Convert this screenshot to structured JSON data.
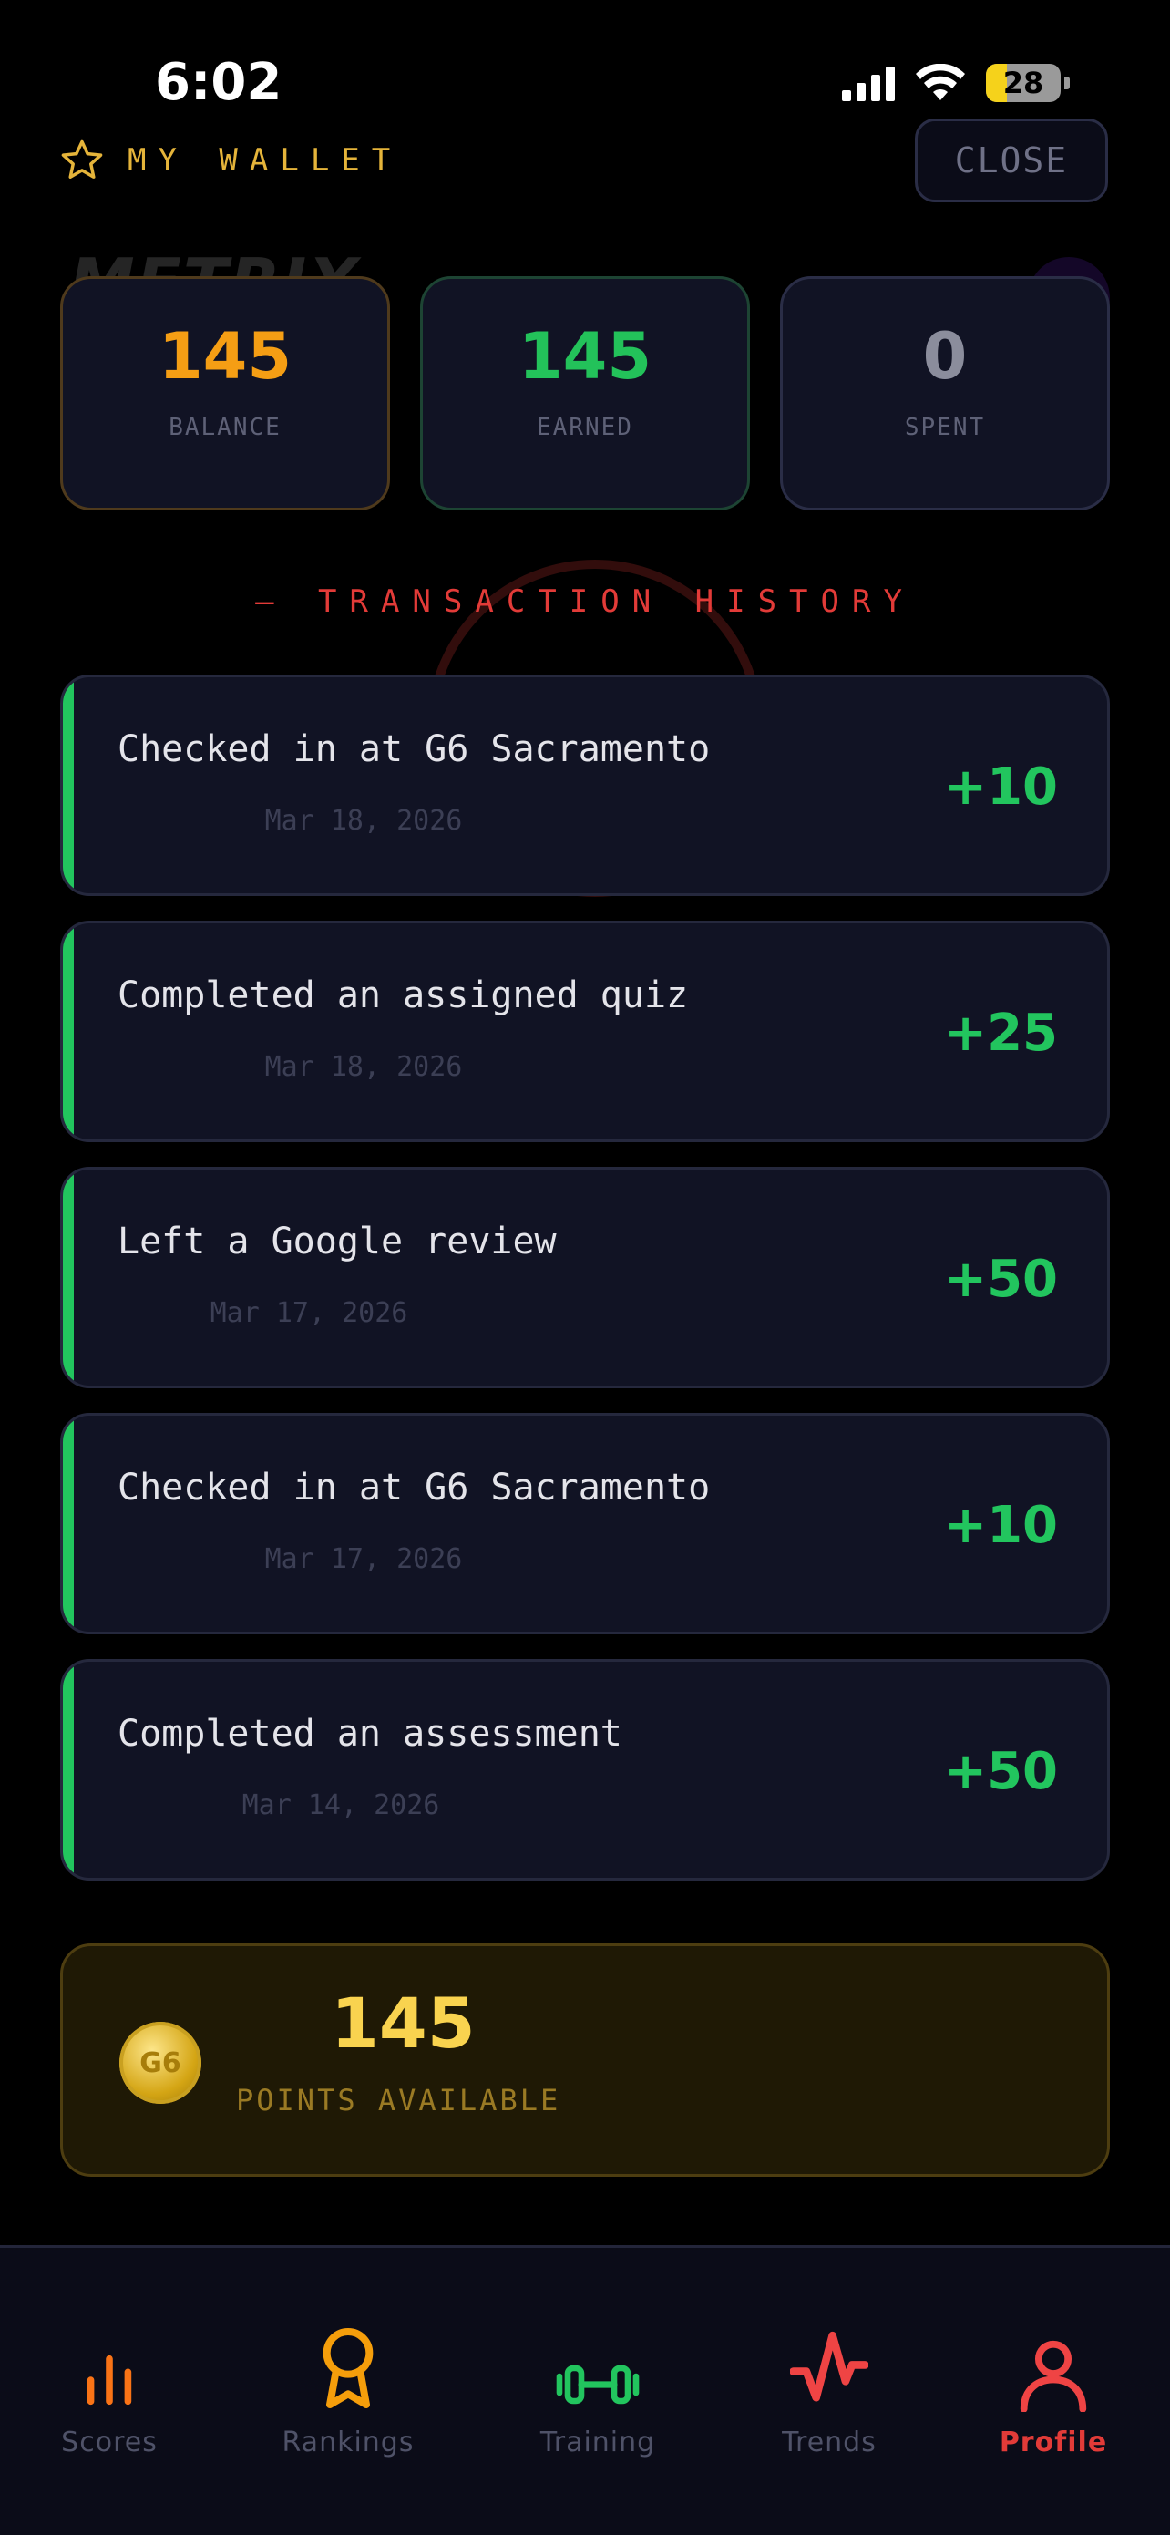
{
  "status_bar": {
    "time": "6:02",
    "battery": "28"
  },
  "background_hint": {
    "brand": "METRIX"
  },
  "header": {
    "title": "MY WALLET",
    "close_label": "CLOSE"
  },
  "stats": [
    {
      "value": "145",
      "label": "BALANCE"
    },
    {
      "value": "145",
      "label": "EARNED"
    },
    {
      "value": "0",
      "label": "SPENT"
    }
  ],
  "history_title": "— TRANSACTION HISTORY",
  "transactions": [
    {
      "description": "Checked in at G6 Sacramento",
      "date": "Mar 18, 2026",
      "amount": "+10"
    },
    {
      "description": "Completed an assigned quiz",
      "date": "Mar 18, 2026",
      "amount": "+25"
    },
    {
      "description": "Left a Google review",
      "date": "Mar 17, 2026",
      "amount": "+50"
    },
    {
      "description": "Checked in at G6 Sacramento",
      "date": "Mar 17, 2026",
      "amount": "+10"
    },
    {
      "description": "Completed an assessment",
      "date": "Mar 14, 2026",
      "amount": "+50"
    }
  ],
  "points": {
    "coin_label": "G6",
    "value": "145",
    "label": "POINTS AVAILABLE"
  },
  "tabs": [
    {
      "label": "Scores",
      "icon": "bar-chart-icon"
    },
    {
      "label": "Rankings",
      "icon": "award-icon"
    },
    {
      "label": "Training",
      "icon": "dumbbell-icon"
    },
    {
      "label": "Trends",
      "icon": "activity-icon"
    },
    {
      "label": "Profile",
      "icon": "user-icon",
      "active": true
    }
  ],
  "colors": {
    "accent_red": "#e23b38",
    "gold": "#f59e14",
    "green": "#22c55e"
  }
}
